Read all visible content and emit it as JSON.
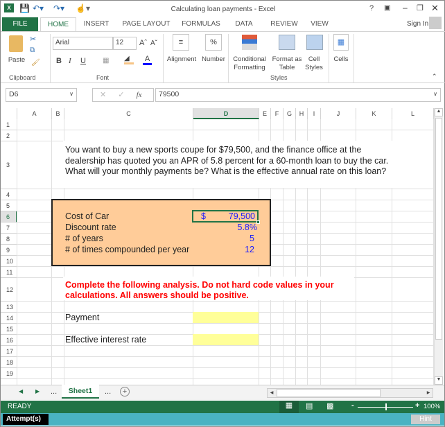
{
  "window": {
    "title": "Calculating loan payments - Excel",
    "sign_in": "Sign In"
  },
  "ribbon_tabs": [
    "FILE",
    "HOME",
    "INSERT",
    "PAGE LAYOUT",
    "FORMULAS",
    "DATA",
    "REVIEW",
    "VIEW"
  ],
  "ribbon": {
    "paste": "Paste",
    "clipboard": "Clipboard",
    "font_name": "Arial",
    "font_size": "12",
    "font": "Font",
    "alignment": "Alignment",
    "number": "Number",
    "conditional": "Conditional",
    "formatting": "Formatting",
    "format_as": "Format as",
    "table": "Table",
    "cell": "Cell",
    "styles_btn": "Styles",
    "styles": "Styles",
    "cells": "Cells",
    "bold": "B",
    "italic": "I",
    "underline": "U"
  },
  "formula_bar": {
    "name_box": "D6",
    "fx": "fx",
    "value": "79500"
  },
  "columns": [
    "A",
    "B",
    "C",
    "D",
    "E",
    "F",
    "G",
    "H",
    "I",
    "J",
    "K",
    "L"
  ],
  "rows": [
    "1",
    "2",
    "3",
    "4",
    "5",
    "6",
    "7",
    "8",
    "9",
    "10",
    "11",
    "12",
    "13",
    "14",
    "15",
    "16",
    "17",
    "18",
    "19"
  ],
  "cells": {
    "C3": "You want to buy a new sports coupe for $79,500, and the finance office at the dealership has quoted you an APR of 5.8 percent for a 60-month loan to buy the car. What will your monthly payments be? What is the effective annual rate on this loan?",
    "C6": "Cost of Car",
    "D6_sym": "$",
    "D6": "79,500",
    "C7": "Discount rate",
    "D7": "5.8%",
    "C8": "# of years",
    "D8": "5",
    "C9": "# of times compounded per year",
    "D9": "12",
    "C12": "Complete the following analysis. Do not hard code values in your calculations. All answers should be positive.",
    "C14": "Payment",
    "C16": "Effective interest rate"
  },
  "sheet_tabs": {
    "active": "Sheet1",
    "ellipsis": "..."
  },
  "status": {
    "ready": "READY",
    "zoom": "100%"
  },
  "footer": {
    "attempts": "Attempt(s)",
    "hint": "Hint"
  },
  "colors": {
    "excel_green": "#217346",
    "box_fill": "#ffcc99",
    "input_fill": "#ffff99",
    "red_text": "#ff0000",
    "blue_text": "#1a1aff",
    "footer_teal": "#4ab3c2"
  }
}
